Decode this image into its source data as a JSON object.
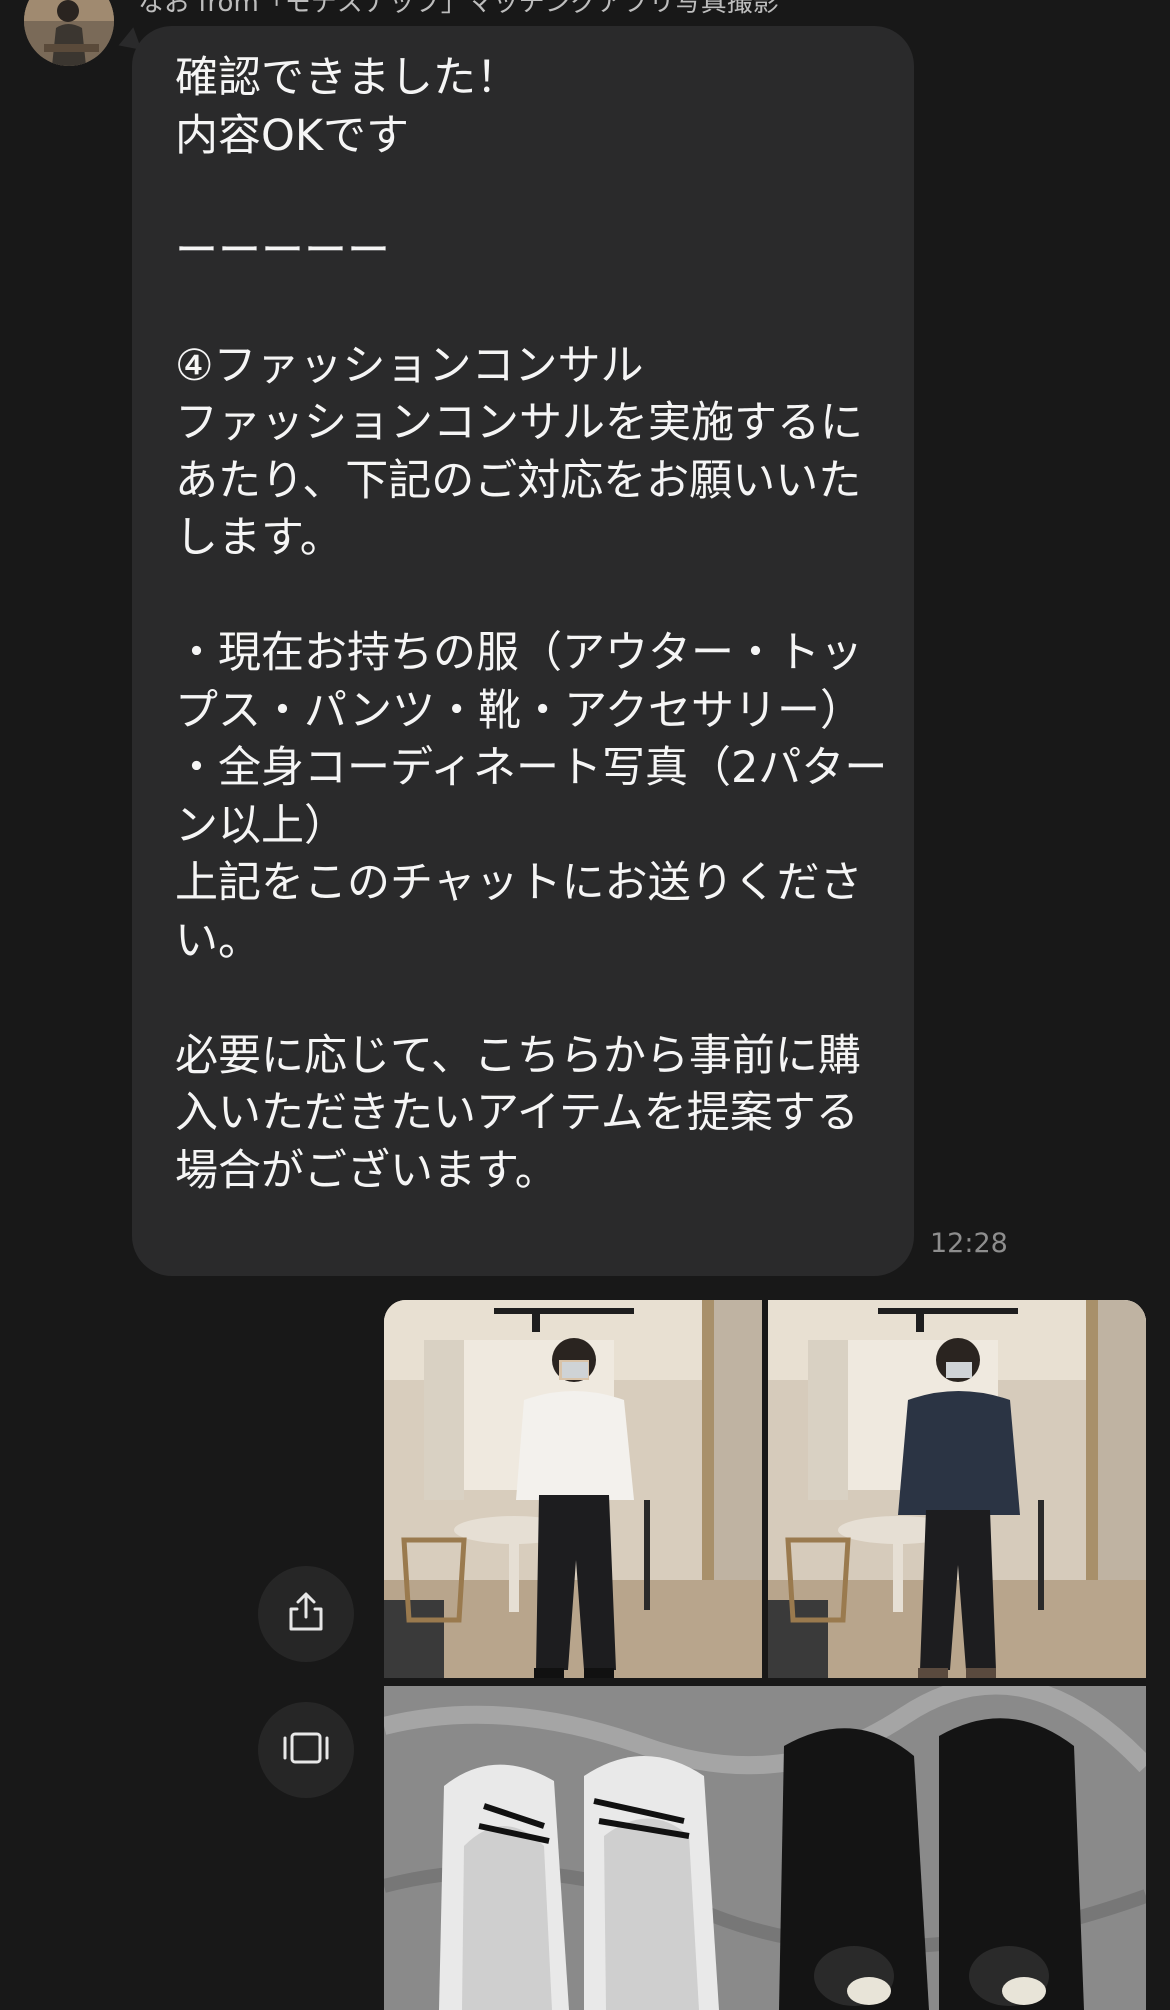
{
  "chat": {
    "sender_name": "なお from「モテスナップ」マッチングアプリ写真撮影",
    "message_text": "確認できました！\n内容OKです\n\nーーーーー\n\n④ファッションコンサル\nファッションコンサルを実施するにあたり、下記のご対応をお願いいたします。\n\n・現在お持ちの服（アウター・トップス・パンツ・靴・アクセサリー）\n・全身コーディネート写真（2パターン以上）\n上記をこのチャットにお送りください。\n\n必要に応じて、こちらから事前に購入いただきたいアイテムを提案する場合がございます。",
    "timestamp": "12:28"
  },
  "actions": {
    "share_icon": "share-icon",
    "gallery_icon": "gallery-icon"
  },
  "photos": [
    {
      "icon": "mirror-selfie-white-shirt"
    },
    {
      "icon": "mirror-selfie-denim-jacket"
    },
    {
      "icon": "shoes-photo"
    }
  ],
  "colors": {
    "background": "#181818",
    "bubble": "#2a2a2b",
    "text": "#f5f5f5",
    "timestamp": "#8e8e8e"
  }
}
